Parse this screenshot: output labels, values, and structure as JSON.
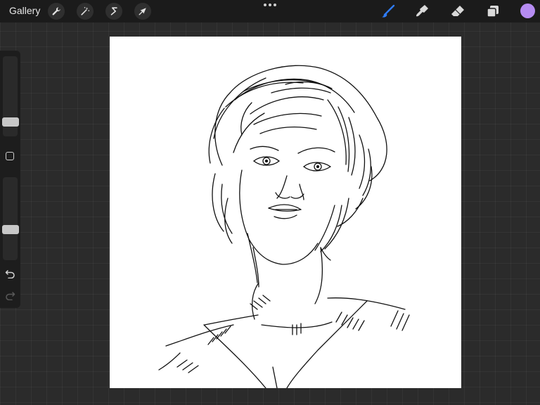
{
  "topbar": {
    "gallery_label": "Gallery",
    "left_tools": [
      "wrench-icon",
      "magic-wand-icon",
      "selection-icon",
      "transform-arrow-icon"
    ],
    "right_tools": [
      "brush-icon",
      "smudge-icon",
      "eraser-icon",
      "layers-icon"
    ],
    "active_tool": "brush",
    "accent_color": "#2f7cf6",
    "current_color": "#b68cf2"
  },
  "sidebar": {
    "brush_size_level": 0.2,
    "opacity_level": 0.37,
    "controls": [
      "brush-size-slider",
      "modify-button",
      "opacity-slider",
      "undo-icon",
      "redo-icon"
    ]
  },
  "canvas": {
    "background": "#ffffff",
    "artwork": "sketch-portrait-drawing"
  }
}
